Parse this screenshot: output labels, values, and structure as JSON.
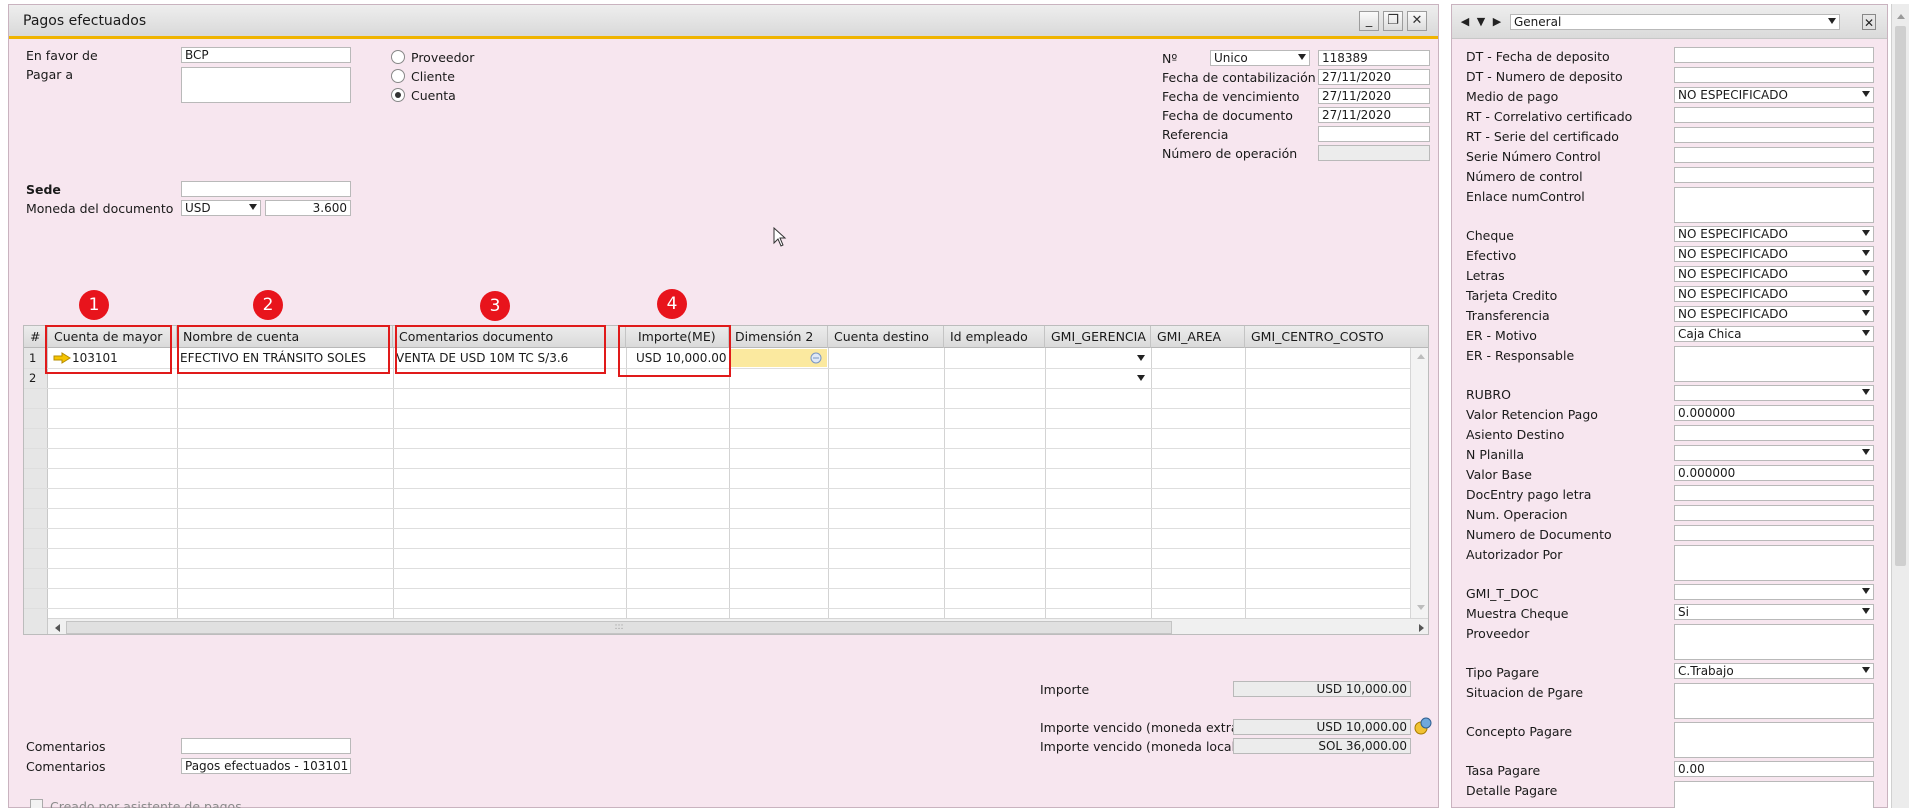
{
  "window": {
    "title": "Pagos efectuados",
    "btn_minimize": "_",
    "btn_restore": "❐",
    "btn_close": "✕"
  },
  "header": {
    "en_favor_de_label": "En favor de",
    "en_favor_de_value": "BCP",
    "pagar_a_label": "Pagar a",
    "pagar_a_value": "",
    "radio_proveedor": "Proveedor",
    "radio_cliente": "Cliente",
    "radio_cuenta": "Cuenta",
    "selected_radio": "Cuenta",
    "sede_label": "Sede",
    "sede_value": "",
    "moneda_label": "Moneda del documento",
    "moneda_value": "USD",
    "tipo_cambio": "3.600"
  },
  "doc_info": {
    "numero_label": "Nº",
    "serie": "Unico",
    "numero": "118389",
    "fecha_contabilizacion_label": "Fecha de contabilización",
    "fecha_contabilizacion": "27/11/2020",
    "fecha_vencimiento_label": "Fecha de vencimiento",
    "fecha_vencimiento": "27/11/2020",
    "fecha_documento_label": "Fecha de documento",
    "fecha_documento": "27/11/2020",
    "referencia_label": "Referencia",
    "referencia": "",
    "numero_operacion_label": "Número de operación",
    "numero_operacion": ""
  },
  "grid": {
    "columns": [
      "#",
      "Cuenta de mayor",
      "Nombre de cuenta",
      "Comentarios documento",
      "Importe(ME)",
      "Dimensión 2",
      "Cuenta destino",
      "Id empleado",
      "GMI_GERENCIA",
      "GMI_AREA",
      "GMI_CENTRO_COSTO"
    ],
    "rows": [
      {
        "num": "1",
        "cuenta": "103101",
        "nombre": "EFECTIVO EN TRÁNSITO SOLES",
        "comentarios": "VENTA DE USD 10M TC S/3.6",
        "importe": "USD 10,000.00"
      },
      {
        "num": "2",
        "cuenta": "",
        "nombre": "",
        "comentarios": "",
        "importe": ""
      }
    ],
    "callouts": [
      "1",
      "2",
      "3",
      "4"
    ],
    "h_scroll_grip": ":::"
  },
  "totals": {
    "importe_label": "Importe",
    "importe": "USD 10,000.00",
    "vencido_extra_label": "Importe vencido (moneda extran",
    "vencido_extra": "USD 10,000.00",
    "vencido_local_label": "Importe vencido (moneda local)",
    "vencido_local": "SOL 36,000.00"
  },
  "footer": {
    "comentarios_label_1": "Comentarios",
    "comentarios_value_1": "",
    "comentarios_label_2": "Comentarios",
    "comentarios_value_2": "Pagos efectuados - 103101",
    "asistente_label": "Creado por asistente de pagos"
  },
  "side": {
    "category": "General",
    "nav_first": "◀",
    "nav_down": "▼",
    "nav_next": "▶",
    "close": "✕",
    "fields": [
      {
        "label": "DT - Fecha de deposito",
        "value": "",
        "dropdown": false,
        "tall": false
      },
      {
        "label": "DT - Numero de deposito",
        "value": "",
        "dropdown": false,
        "tall": false
      },
      {
        "label": "Medio de pago",
        "value": "NO ESPECIFICADO",
        "dropdown": true,
        "tall": false
      },
      {
        "label": "RT - Correlativo certificado",
        "value": "",
        "dropdown": false,
        "tall": false
      },
      {
        "label": "RT - Serie del certificado",
        "value": "",
        "dropdown": false,
        "tall": false
      },
      {
        "label": "Serie Número Control",
        "value": "",
        "dropdown": false,
        "tall": false
      },
      {
        "label": "Número de control",
        "value": "",
        "dropdown": false,
        "tall": false
      },
      {
        "label": "Enlace numControl",
        "value": "",
        "dropdown": false,
        "tall": true
      },
      {
        "label": "Cheque",
        "value": "NO ESPECIFICADO",
        "dropdown": true,
        "tall": false
      },
      {
        "label": "Efectivo",
        "value": "NO ESPECIFICADO",
        "dropdown": true,
        "tall": false
      },
      {
        "label": "Letras",
        "value": "NO ESPECIFICADO",
        "dropdown": true,
        "tall": false
      },
      {
        "label": "Tarjeta Credito",
        "value": "NO ESPECIFICADO",
        "dropdown": true,
        "tall": false
      },
      {
        "label": "Transferencia",
        "value": "NO ESPECIFICADO",
        "dropdown": true,
        "tall": false
      },
      {
        "label": "ER - Motivo",
        "value": "Caja Chica",
        "dropdown": true,
        "tall": false
      },
      {
        "label": "ER - Responsable",
        "value": "",
        "dropdown": false,
        "tall": true
      },
      {
        "label": "RUBRO",
        "value": "",
        "dropdown": true,
        "tall": false
      },
      {
        "label": "Valor Retencion Pago",
        "value": "0.000000",
        "dropdown": false,
        "tall": false
      },
      {
        "label": "Asiento Destino",
        "value": "",
        "dropdown": false,
        "tall": false
      },
      {
        "label": "N Planilla",
        "value": "",
        "dropdown": true,
        "tall": false
      },
      {
        "label": "Valor Base",
        "value": "0.000000",
        "dropdown": false,
        "tall": false
      },
      {
        "label": "DocEntry pago letra",
        "value": "",
        "dropdown": false,
        "tall": false
      },
      {
        "label": "Num. Operacion",
        "value": "",
        "dropdown": false,
        "tall": false
      },
      {
        "label": "Numero de Documento",
        "value": "",
        "dropdown": false,
        "tall": false
      },
      {
        "label": "Autorizador Por",
        "value": "",
        "dropdown": false,
        "tall": true
      },
      {
        "label": "GMI_T_DOC",
        "value": "",
        "dropdown": true,
        "tall": false
      },
      {
        "label": "Muestra Cheque",
        "value": "Si",
        "dropdown": true,
        "tall": false
      },
      {
        "label": "Proveedor",
        "value": "",
        "dropdown": false,
        "tall": true
      },
      {
        "label": "Tipo Pagare",
        "value": "C.Trabajo",
        "dropdown": true,
        "tall": false
      },
      {
        "label": "Situacion de Pgare",
        "value": "",
        "dropdown": false,
        "tall": true
      },
      {
        "label": "Concepto Pagare",
        "value": "",
        "dropdown": false,
        "tall": true
      },
      {
        "label": "Tasa Pagare",
        "value": "0.00",
        "dropdown": false,
        "tall": false
      },
      {
        "label": "Detalle Pagare",
        "value": "",
        "dropdown": false,
        "tall": true
      }
    ]
  },
  "colors": {
    "form_bg": "#f7e6ef",
    "title_accent": "#f0b400",
    "callout_red": "#e8141c"
  }
}
